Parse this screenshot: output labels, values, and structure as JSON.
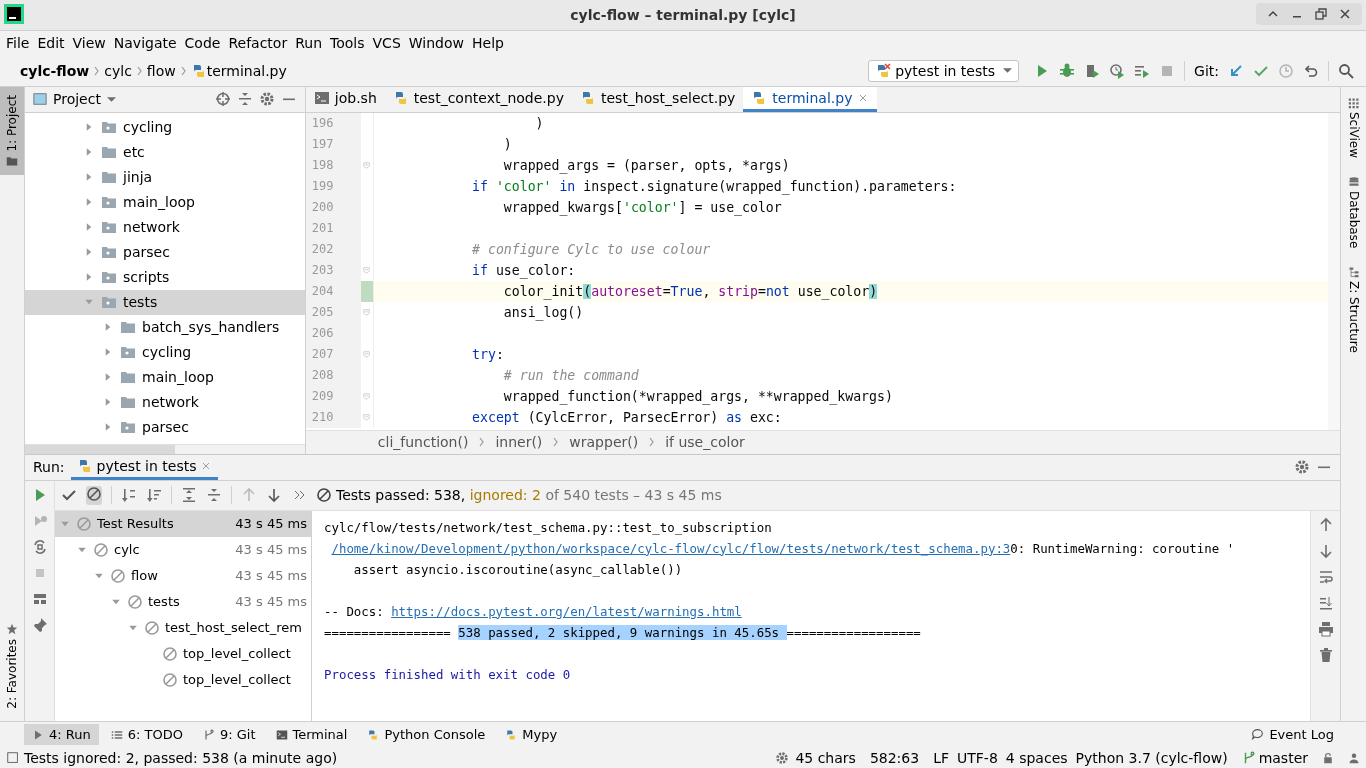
{
  "window": {
    "title": "cylc-flow – terminal.py [cylc]"
  },
  "menu": [
    "File",
    "Edit",
    "View",
    "Navigate",
    "Code",
    "Refactor",
    "Run",
    "Tools",
    "VCS",
    "Window",
    "Help"
  ],
  "breadcrumbs": [
    "cylc-flow",
    "cylc",
    "flow",
    "terminal.py"
  ],
  "run_config": "pytest in tests",
  "git_label": "Git:",
  "left_stripe": [
    {
      "label": "1: Project",
      "selected": true
    },
    {
      "label": "2: Favorites",
      "selected": false
    }
  ],
  "right_stripe": [
    "SciView",
    "Database",
    "Z: Structure"
  ],
  "project": {
    "title": "Project",
    "tree": [
      {
        "name": "cycling",
        "expanded": false,
        "selected": false
      },
      {
        "name": "etc",
        "expanded": false,
        "selected": false
      },
      {
        "name": "jinja",
        "expanded": false,
        "selected": false
      },
      {
        "name": "main_loop",
        "expanded": false,
        "selected": false
      },
      {
        "name": "network",
        "expanded": false,
        "selected": false
      },
      {
        "name": "parsec",
        "expanded": false,
        "selected": false
      },
      {
        "name": "scripts",
        "expanded": false,
        "selected": false
      },
      {
        "name": "tests",
        "expanded": true,
        "selected": true,
        "children": [
          {
            "name": "batch_sys_handlers",
            "expanded": false,
            "selected": false
          },
          {
            "name": "cycling",
            "expanded": false,
            "selected": false
          },
          {
            "name": "main_loop",
            "expanded": false,
            "selected": false
          },
          {
            "name": "network",
            "expanded": false,
            "selected": false
          },
          {
            "name": "parsec",
            "expanded": false,
            "selected": false
          }
        ]
      }
    ]
  },
  "editor_tabs": [
    {
      "label": "job.sh",
      "kind": "shell",
      "selected": false
    },
    {
      "label": "test_context_node.py",
      "kind": "python",
      "selected": false
    },
    {
      "label": "test_host_select.py",
      "kind": "python",
      "selected": false
    },
    {
      "label": "terminal.py",
      "kind": "python",
      "selected": true
    }
  ],
  "code": [
    {
      "number": "196",
      "fold": false,
      "current": false,
      "tokens": [
        {
          "kind": "plain",
          "text": "                    )"
        }
      ]
    },
    {
      "number": "197",
      "fold": false,
      "current": false,
      "tokens": [
        {
          "kind": "plain",
          "text": "                )"
        }
      ]
    },
    {
      "number": "198",
      "fold": true,
      "current": false,
      "tokens": [
        {
          "kind": "plain",
          "text": "                wrapped_args = (parser, opts, *args)"
        }
      ]
    },
    {
      "number": "199",
      "fold": false,
      "current": false,
      "tokens": [
        {
          "kind": "keyword",
          "text": "            if"
        },
        {
          "kind": "string",
          "text": " 'color'"
        },
        {
          "kind": "keyword",
          "text": " in"
        },
        {
          "kind": "plain",
          "text": " inspect.signature(wrapped_function).parameters:"
        }
      ]
    },
    {
      "number": "200",
      "fold": false,
      "current": false,
      "tokens": [
        {
          "kind": "plain",
          "text": "                wrapped_kwargs["
        },
        {
          "kind": "string",
          "text": "'color'"
        },
        {
          "kind": "plain",
          "text": "] = use_color"
        }
      ]
    },
    {
      "number": "201",
      "fold": false,
      "current": false
    },
    {
      "number": "202",
      "fold": false,
      "current": false,
      "tokens": [
        {
          "kind": "comment",
          "text": "            # configure Cylc to use colour"
        }
      ]
    },
    {
      "number": "203",
      "fold": true,
      "current": false,
      "tokens": [
        {
          "kind": "keyword",
          "text": "            if"
        },
        {
          "kind": "plain",
          "text": " use_color:"
        }
      ]
    },
    {
      "number": "204",
      "fold": false,
      "current": true,
      "tokens": [
        {
          "kind": "plain",
          "text": "                color_init"
        },
        {
          "kind": "brace",
          "text": "("
        },
        {
          "kind": "param",
          "text": "autoreset"
        },
        {
          "kind": "plain",
          "text": "="
        },
        {
          "kind": "keyword",
          "text": "True"
        },
        {
          "kind": "plain",
          "text": ", "
        },
        {
          "kind": "param",
          "text": "strip"
        },
        {
          "kind": "plain",
          "text": "="
        },
        {
          "kind": "keyword",
          "text": "not"
        },
        {
          "kind": "plain",
          "text": " use_color"
        },
        {
          "kind": "brace",
          "text": ")"
        }
      ]
    },
    {
      "number": "205",
      "fold": true,
      "current": false,
      "tokens": [
        {
          "kind": "plain",
          "text": "                ansi_log()"
        }
      ]
    },
    {
      "number": "206",
      "fold": false,
      "current": false
    },
    {
      "number": "207",
      "fold": true,
      "current": false,
      "tokens": [
        {
          "kind": "keyword",
          "text": "            try"
        },
        {
          "kind": "plain",
          "text": ":"
        }
      ]
    },
    {
      "number": "208",
      "fold": false,
      "current": false,
      "tokens": [
        {
          "kind": "comment",
          "text": "                # run the command"
        }
      ]
    },
    {
      "number": "209",
      "fold": true,
      "current": false,
      "tokens": [
        {
          "kind": "plain",
          "text": "                wrapped_function(*wrapped_args, **wrapped_kwargs)"
        }
      ]
    },
    {
      "number": "210",
      "fold": true,
      "current": false,
      "tokens": [
        {
          "kind": "keyword",
          "text": "            except"
        },
        {
          "kind": "plain",
          "text": " (CylcError, ParsecError) "
        },
        {
          "kind": "keyword",
          "text": "as"
        },
        {
          "kind": "plain",
          "text": " exc:"
        }
      ]
    }
  ],
  "editor_breadcrumbs": [
    "cli_function()",
    "inner()",
    "wrapper()",
    "if use_color"
  ],
  "run": {
    "label": "Run:",
    "tab": "pytest in tests",
    "summary": {
      "passed": "Tests passed: 538,",
      "ignored": "ignored: 2",
      "rest": "of 540 tests – 43 s 45 ms"
    },
    "tree": [
      {
        "name": "Test Results",
        "time": "43 s 45 ms",
        "expanded": true,
        "selected": true,
        "children": [
          {
            "name": "cylc",
            "time": "43 s 45 ms",
            "expanded": true,
            "selected": false,
            "children": [
              {
                "name": "flow",
                "time": "43 s 45 ms",
                "expanded": true,
                "selected": false,
                "children": [
                  {
                    "name": "tests",
                    "time": "43 s 45 ms",
                    "expanded": true,
                    "selected": false,
                    "children": [
                      {
                        "name": "test_host_select_rem",
                        "expanded": true,
                        "selected": false,
                        "children": [
                          {
                            "name": "top_level_collect",
                            "selected": false
                          },
                          {
                            "name": "top_level_collect",
                            "selected": false
                          }
                        ]
                      }
                    ]
                  }
                ]
              }
            ]
          }
        ]
      }
    ],
    "console": [
      {
        "kind": "output",
        "segments": [
          {
            "kind": "plain",
            "text": "cylc/flow/tests/network/test_schema.py::test_to_subscription"
          }
        ]
      },
      {
        "kind": "output",
        "segments": [
          {
            "kind": "link",
            "text": "/home/kinow/Development/python/workspace/cylc-flow/cylc/flow/tests/network/test_schema.py:3"
          },
          {
            "kind": "plain",
            "text": "0: RuntimeWarning: coroutine '"
          }
        ]
      },
      {
        "kind": "output",
        "segments": [
          {
            "kind": "plain",
            "text": "    assert asyncio.iscoroutine(async_callable())"
          }
        ]
      },
      {
        "kind": "blank"
      },
      {
        "kind": "output",
        "segments": [
          {
            "kind": "plain",
            "text": "-- Docs: "
          },
          {
            "kind": "link",
            "text": "https://docs.pytest.org/en/latest/warnings.html"
          }
        ]
      },
      {
        "kind": "output",
        "segments": [
          {
            "kind": "plain",
            "text": "================= "
          },
          {
            "kind": "highlight",
            "text": "538 passed, 2 skipped, 9 warnings in 45.65s "
          },
          {
            "kind": "plain",
            "text": "=================="
          }
        ]
      },
      {
        "kind": "blank"
      },
      {
        "kind": "output",
        "segments": [
          {
            "kind": "process",
            "text": "Process finished with exit code 0"
          }
        ]
      }
    ]
  },
  "tool_windows": [
    {
      "label": "4: Run",
      "kind": "run",
      "selected": true
    },
    {
      "label": "6: TODO",
      "kind": "todo",
      "selected": false
    },
    {
      "label": "9: Git",
      "kind": "git",
      "selected": false
    },
    {
      "label": "Terminal",
      "kind": "terminal",
      "selected": false
    },
    {
      "label": "Python Console",
      "kind": "python",
      "selected": false
    },
    {
      "label": "Mypy",
      "kind": "python",
      "selected": false
    }
  ],
  "event_log": "Event Log",
  "status": {
    "message": "Tests ignored: 2, passed: 538 (a minute ago)",
    "chars": "45 chars",
    "position": "582:63",
    "line_sep": "LF",
    "encoding": "UTF-8",
    "indent": "4 spaces",
    "interpreter": "Python 3.7 (cylc-flow)",
    "branch": "master"
  }
}
